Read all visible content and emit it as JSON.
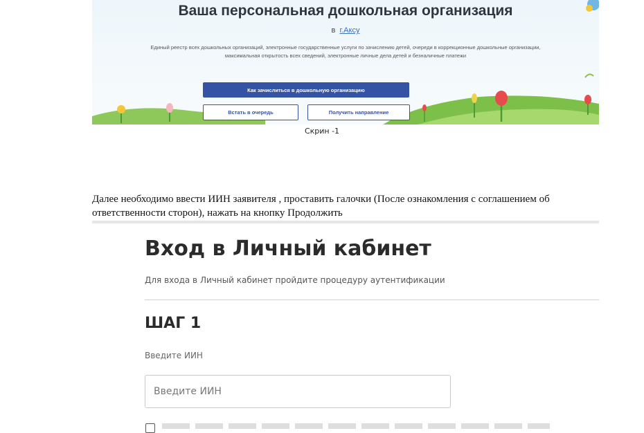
{
  "banner": {
    "title": "Ваша персональная дошкольная организация",
    "city_prefix": "в",
    "city": "г.Аксу",
    "description": "Единый реестр всех дошкольных организаций, электронные государственные услуги по зачислению детей, очереди в коррекционные дошкольные организации, максимальная открытость всех сведений, электронные личные дела детей и безналичные платежи",
    "primary_button": "Как зачислиться в дошкольную организацию",
    "queue_button": "Встать в очередь",
    "direction_button": "Получить направление",
    "colors": {
      "primary": "#3553a5",
      "grass": "#7cc04a",
      "flower": "#e84b4b"
    }
  },
  "caption": "Скрин -1",
  "instruction": "Далее необходимо ввести  ИИН заявителя , проставить галочки (После ознакомления с соглашением об ответственности сторон), нажать на кнопку Продолжить",
  "login": {
    "title": "Вход в Личный кабинет",
    "subtitle": "Для входа в Личный кабинет пройдите процедуру аутентификации",
    "step": "ШАГ 1",
    "iin_label": "Введите ИИН",
    "iin_placeholder": "Введите ИИН",
    "iin_value": ""
  }
}
